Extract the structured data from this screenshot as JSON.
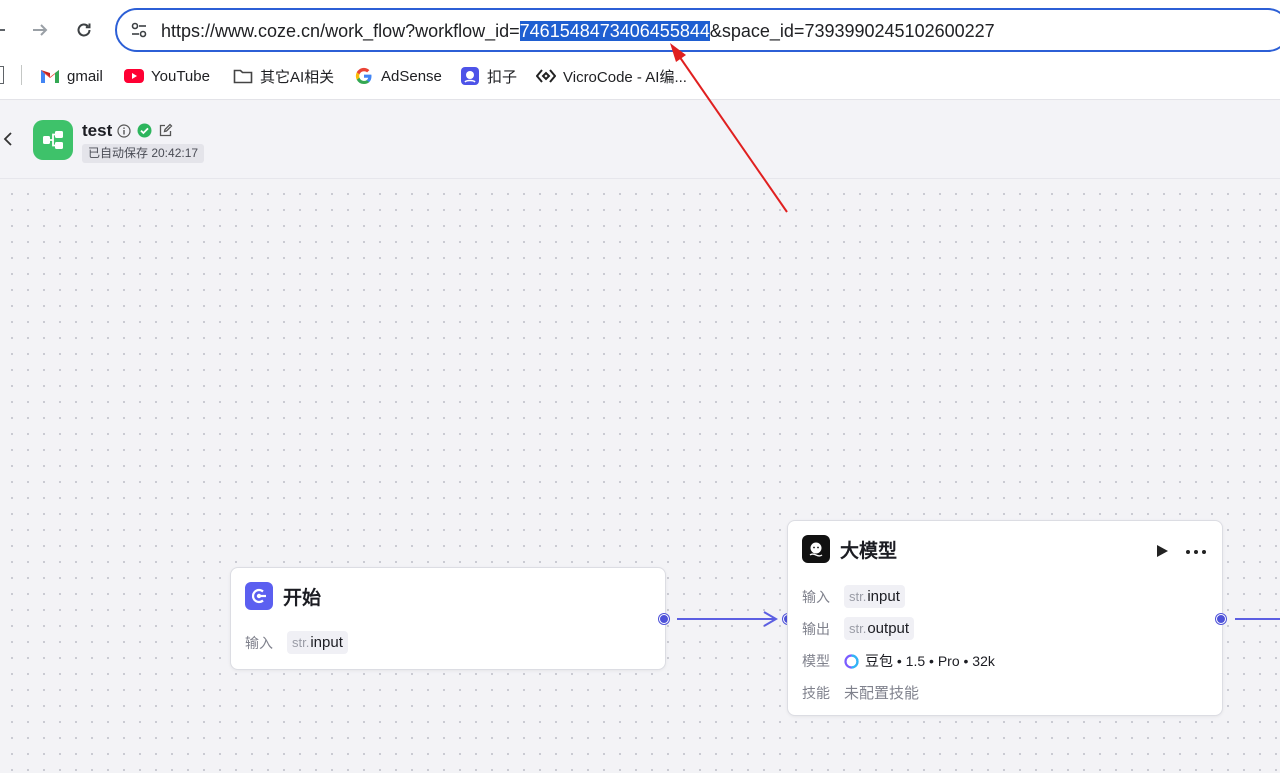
{
  "browser": {
    "url_prefix": "https://www.coze.cn/work_flow?workflow_id=",
    "url_highlight": "7461548473406455844",
    "url_suffix": "&space_id=7393990245102600227",
    "bookmarks": [
      {
        "label": "gmail",
        "icon": "gmail-icon"
      },
      {
        "label": "YouTube",
        "icon": "youtube-icon"
      },
      {
        "label": "其它AI相关",
        "icon": "folder-icon"
      },
      {
        "label": "AdSense",
        "icon": "google-icon"
      },
      {
        "label": "扣子",
        "icon": "coze-icon"
      },
      {
        "label": "VicroCode - AI编...",
        "icon": "vicrocode-icon"
      }
    ]
  },
  "app": {
    "title": "test",
    "autosave": "已自动保存 20:42:17",
    "accent": "#4e52d9",
    "logo_color": "#3ec26a"
  },
  "nodes": {
    "start": {
      "title": "开始",
      "input_label": "输入",
      "input_type": "str.",
      "input_name": "input"
    },
    "llm": {
      "title": "大模型",
      "input_label": "输入",
      "input_type": "str.",
      "input_name": "input",
      "output_label": "输出",
      "output_type": "str.",
      "output_name": "output",
      "model_label": "模型",
      "model_value": "豆包 • 1.5 • Pro • 32k",
      "skill_label": "技能",
      "skill_value": "未配置技能"
    }
  }
}
